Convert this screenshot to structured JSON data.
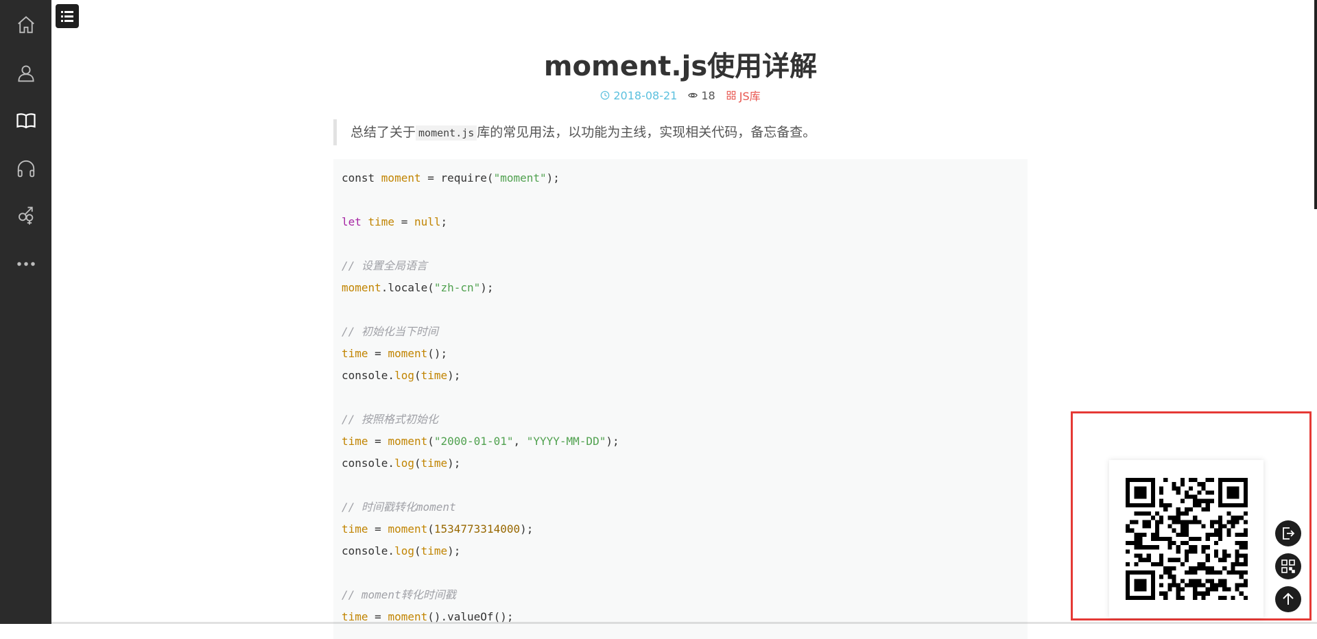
{
  "sidebar": {
    "items": [
      {
        "icon": "home-icon"
      },
      {
        "icon": "user-icon"
      },
      {
        "icon": "book-icon"
      },
      {
        "icon": "headphones-icon"
      },
      {
        "icon": "gender-icon"
      },
      {
        "icon": "more-icon"
      }
    ]
  },
  "toolbar": {
    "menu_icon": "menu-icon"
  },
  "article": {
    "title": "moment.js使用详解",
    "meta": {
      "date": "2018-08-21",
      "views": "18",
      "category": "JS库"
    },
    "summary": {
      "before": "总结了关于",
      "code": "moment.js",
      "after": "库的常见用法，以功能为主线，实现相关代码，备忘备查。"
    },
    "code_lines": [
      [
        {
          "t": "",
          "v": "const "
        },
        {
          "t": "var",
          "v": "moment"
        },
        {
          "t": "",
          "v": " = require("
        },
        {
          "t": "str",
          "v": "\"moment\""
        },
        {
          "t": "",
          "v": ");"
        }
      ],
      [],
      [
        {
          "t": "kw",
          "v": "let "
        },
        {
          "t": "var",
          "v": "time"
        },
        {
          "t": "",
          "v": " = "
        },
        {
          "t": "var",
          "v": "null"
        },
        {
          "t": "",
          "v": ";"
        }
      ],
      [],
      [
        {
          "t": "cm",
          "v": "// 设置全局语言"
        }
      ],
      [
        {
          "t": "var",
          "v": "moment"
        },
        {
          "t": "",
          "v": ".locale("
        },
        {
          "t": "str",
          "v": "\"zh-cn\""
        },
        {
          "t": "",
          "v": ");"
        }
      ],
      [],
      [
        {
          "t": "cm",
          "v": "// 初始化当下时间"
        }
      ],
      [
        {
          "t": "var",
          "v": "time"
        },
        {
          "t": "",
          "v": " = "
        },
        {
          "t": "fn",
          "v": "moment"
        },
        {
          "t": "",
          "v": "();"
        }
      ],
      [
        {
          "t": "",
          "v": "console."
        },
        {
          "t": "fn",
          "v": "log"
        },
        {
          "t": "",
          "v": "("
        },
        {
          "t": "var",
          "v": "time"
        },
        {
          "t": "",
          "v": ");"
        }
      ],
      [],
      [
        {
          "t": "cm",
          "v": "// 按照格式初始化"
        }
      ],
      [
        {
          "t": "var",
          "v": "time"
        },
        {
          "t": "",
          "v": " = "
        },
        {
          "t": "fn",
          "v": "moment"
        },
        {
          "t": "",
          "v": "("
        },
        {
          "t": "str",
          "v": "\"2000-01-01\""
        },
        {
          "t": "",
          "v": ", "
        },
        {
          "t": "str",
          "v": "\"YYYY-MM-DD\""
        },
        {
          "t": "",
          "v": ");"
        }
      ],
      [
        {
          "t": "",
          "v": "console."
        },
        {
          "t": "fn",
          "v": "log"
        },
        {
          "t": "",
          "v": "("
        },
        {
          "t": "var",
          "v": "time"
        },
        {
          "t": "",
          "v": ");"
        }
      ],
      [],
      [
        {
          "t": "cm",
          "v": "// 时间戳转化moment"
        }
      ],
      [
        {
          "t": "var",
          "v": "time"
        },
        {
          "t": "",
          "v": " = "
        },
        {
          "t": "fn",
          "v": "moment"
        },
        {
          "t": "",
          "v": "("
        },
        {
          "t": "num",
          "v": "1534773314000"
        },
        {
          "t": "",
          "v": ");"
        }
      ],
      [
        {
          "t": "",
          "v": "console."
        },
        {
          "t": "fn",
          "v": "log"
        },
        {
          "t": "",
          "v": "("
        },
        {
          "t": "var",
          "v": "time"
        },
        {
          "t": "",
          "v": ");"
        }
      ],
      [],
      [
        {
          "t": "cm",
          "v": "// moment转化时间戳"
        }
      ],
      [
        {
          "t": "var",
          "v": "time"
        },
        {
          "t": "",
          "v": " = "
        },
        {
          "t": "fn",
          "v": "moment"
        },
        {
          "t": "",
          "v": "().valueOf();"
        }
      ]
    ]
  },
  "floating_buttons": [
    {
      "icon": "share-icon"
    },
    {
      "icon": "qrcode-icon"
    },
    {
      "icon": "back-to-top-icon"
    }
  ],
  "colors": {
    "sidebar_bg": "#2b2b2b",
    "date_color": "#5bc0de",
    "category_color": "#e8554e",
    "highlight_border": "#e53935"
  }
}
